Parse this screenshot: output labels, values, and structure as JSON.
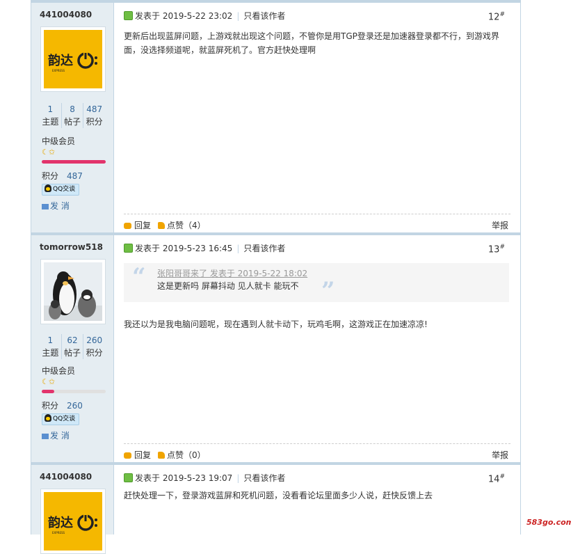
{
  "posts": [
    {
      "author": "441004080",
      "stats": [
        {
          "num": "1",
          "label": "主题"
        },
        {
          "num": "8",
          "label": "帖子"
        },
        {
          "num": "487",
          "label": "积分"
        }
      ],
      "rank": "中级会员",
      "credit_label": "积分",
      "credit": "487",
      "progress": 1.0,
      "qq": "QQ交谈",
      "message_label": "发 消",
      "posted": "发表于 2019-5-22 23:02",
      "only_author": "只看该作者",
      "floor": "12",
      "content": "更新后出现蓝屏问题，上游戏就出现这个问题，不管你是用TGP登录还是加速器登录都不行，到游戏界面，没选择频道呢，就蓝屏死机了。官方赶快处理啊",
      "reply": "回复",
      "like": "点赞（4）",
      "report": "举报"
    },
    {
      "author": "tomorrow518",
      "stats": [
        {
          "num": "1",
          "label": "主题"
        },
        {
          "num": "62",
          "label": "帖子"
        },
        {
          "num": "260",
          "label": "积分"
        }
      ],
      "rank": "中级会员",
      "credit_label": "积分",
      "credit": "260",
      "progress": 0.2,
      "qq": "QQ交谈",
      "message_label": "发 消",
      "posted": "发表于 2019-5-23 16:45",
      "only_author": "只看该作者",
      "floor": "13",
      "quote_head": "张阳哥哥来了 发表于 2019-5-22 18:02",
      "quote_body": "这是更新吗 屏幕抖动   见人就卡  能玩不",
      "content": "我还以为是我电脑问题呢，现在遇到人就卡动下，玩鸡毛啊，这游戏正在加速凉凉!",
      "reply": "回复",
      "like": "点赞（0）",
      "report": "举报"
    },
    {
      "author": "441004080",
      "posted": "发表于 2019-5-23 19:07",
      "only_author": "只看该作者",
      "floor": "14",
      "content": "赶快处理一下，登录游戏蓝屏和死机问题，没看看论坛里面多少人说，赶快反馈上去"
    }
  ],
  "avatar_brand": "韵达",
  "avatar_brand_sub": "EXPRESS",
  "floor_mark": "#",
  "watermark": "583go.com",
  "colors": {
    "sidebar": "#e5edf2",
    "border": "#c2d5e3",
    "link": "#336699",
    "yunda": "#f5b800"
  }
}
